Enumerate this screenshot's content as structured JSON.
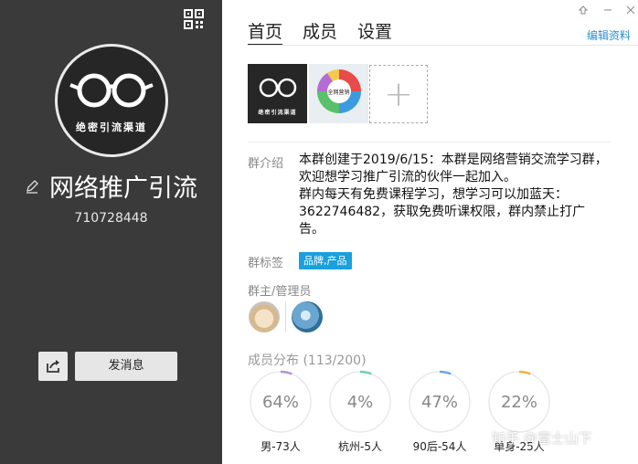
{
  "group": {
    "name": "网络推广引流",
    "id": "710728448",
    "avatar_caption": "绝密引流渠道"
  },
  "actions": {
    "send_message": "发消息"
  },
  "tabs": [
    {
      "label": "首页",
      "active": true
    },
    {
      "label": "成员",
      "active": false
    },
    {
      "label": "设置",
      "active": false
    }
  ],
  "edit_profile": "编辑资料",
  "photos": [
    {
      "caption": "绝密引流渠道"
    },
    {
      "caption": "全网营销"
    }
  ],
  "intro": {
    "label": "群介绍",
    "lines": [
      "本群创建于2019/6/15：本群是网络营销交流学习群，欢迎想学习推广引流的伙伴一起加入。",
      "群内每天有免费课程学习，想学习可以加蓝天：3622746482，获取免费听课权限，群内禁止打广告。"
    ]
  },
  "tags": {
    "label": "群标签",
    "items": [
      "品牌,产品"
    ]
  },
  "admins": {
    "label": "群主/管理员",
    "count": 2
  },
  "members": {
    "label": "成员分布",
    "count_text": "(113/200)",
    "stats": [
      {
        "percent": "64%",
        "value": 64,
        "caption": "男-73人",
        "color": "#b78fd6"
      },
      {
        "percent": "4%",
        "value": 4,
        "caption": "杭州-5人",
        "color": "#6fd0b2"
      },
      {
        "percent": "47%",
        "value": 47,
        "caption": "90后-54人",
        "color": "#6aa7e6"
      },
      {
        "percent": "22%",
        "value": 22,
        "caption": "单身-25人",
        "color": "#f0b63a"
      }
    ]
  },
  "watermark": "知乎 @富士山下",
  "colors": {
    "left_panel": "#3a3a3a",
    "accent_link": "#2a8fd1",
    "tag_bg": "#1aa0dc"
  }
}
